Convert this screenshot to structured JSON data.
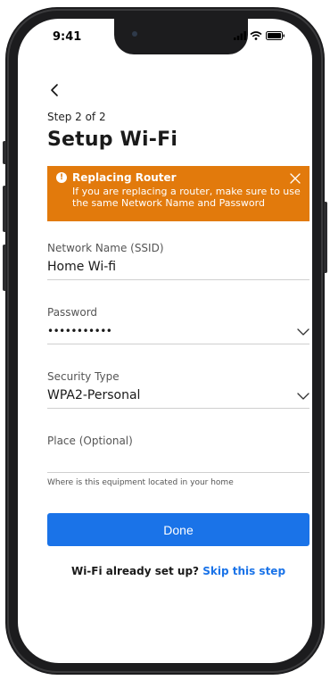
{
  "status_bar": {
    "time": "9:41",
    "icons": [
      "signal-icon",
      "wifi-icon",
      "battery-icon"
    ]
  },
  "nav": {
    "back_icon": "chevron-left-icon"
  },
  "header": {
    "step": "Step 2 of 2",
    "title": "Setup Wi-Fi"
  },
  "alert": {
    "title": "Replacing Router",
    "body": "If you are replacing a router, make sure to use the same Network Name and Password",
    "icon": "alert-circle-icon",
    "close_icon": "close-icon",
    "color": "#e27a0c"
  },
  "form": {
    "network_name": {
      "label": "Network Name (SSID)",
      "value": "Home Wi-fi"
    },
    "password": {
      "label": "Password",
      "value": "•••••••••••"
    },
    "security_type": {
      "label": "Security Type",
      "value": "WPA2-Personal"
    },
    "place": {
      "label": "Place (Optional)",
      "value": "",
      "helper": "Where is this equipment located in your home"
    }
  },
  "actions": {
    "done_label": "Done",
    "skip_prompt": "Wi-Fi already set up?",
    "skip_link": "Skip this step",
    "accent_color": "#1a73e8"
  }
}
